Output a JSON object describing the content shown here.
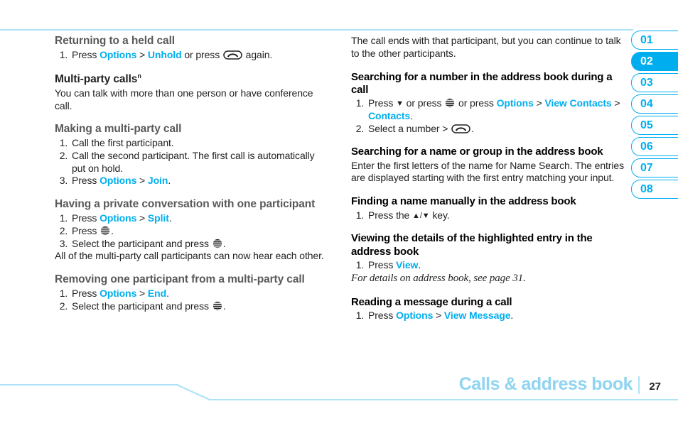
{
  "page": {
    "footer_title": "Calls & address book",
    "page_number": "27"
  },
  "tabs": [
    {
      "label": "01",
      "active": false
    },
    {
      "label": "02",
      "active": true
    },
    {
      "label": "03",
      "active": false
    },
    {
      "label": "04",
      "active": false
    },
    {
      "label": "05",
      "active": false
    },
    {
      "label": "06",
      "active": false
    },
    {
      "label": "07",
      "active": false
    },
    {
      "label": "08",
      "active": false
    }
  ],
  "left_column": {
    "s1": {
      "heading": "Returning to a held call",
      "step1_a": "Press ",
      "step1_options": "Options",
      "step1_gt": " > ",
      "step1_unhold": "Unhold",
      "step1_b": " or press ",
      "step1_c": " again."
    },
    "s2": {
      "heading": "Multi-party calls",
      "heading_sup": "n",
      "body": "You can talk with more than one person or have conference call."
    },
    "s3": {
      "heading": "Making a multi-party call",
      "step1": "Call the first participant.",
      "step2": "Call the second participant. The first call is automatically put on hold.",
      "step3_a": "Press ",
      "step3_options": "Options",
      "step3_gt": " > ",
      "step3_join": "Join",
      "step3_b": "."
    },
    "s4": {
      "heading": "Having a private conversation with one participant",
      "step1_a": "Press ",
      "step1_options": "Options",
      "step1_gt": " > ",
      "step1_split": "Split",
      "step1_b": ".",
      "step2_a": "Press ",
      "step2_b": ".",
      "step3_a": "Select the participant and press ",
      "step3_b": ".",
      "note": "All of the multi-party call participants can now hear each other."
    },
    "s5": {
      "heading": "Removing one participant from a multi-party call",
      "step1_a": "Press ",
      "step1_options": "Options",
      "step1_gt": " > ",
      "step1_end": "End",
      "step1_b": ".",
      "step2_a": "Select the participant and press ",
      "step2_b": "."
    }
  },
  "right_column": {
    "s0": {
      "body": "The call ends with that participant, but you can continue to talk to the other participants."
    },
    "s1": {
      "heading": "Searching for a number in the address book during a call",
      "step1_a": "Press ",
      "step1_down": "▼",
      "step1_b": " or press ",
      "step1_c": " or press ",
      "step1_options": "Options",
      "step1_gt1": " > ",
      "step1_viewcontacts": "View Contacts",
      "step1_gt2": " > ",
      "step1_contacts": "Contacts",
      "step1_d": ".",
      "step2_a": "Select a number > ",
      "step2_b": "."
    },
    "s2": {
      "heading": "Searching for a name or group in the address book",
      "body": "Enter the first letters of the name for Name Search. The entries are displayed starting with the first entry matching your input."
    },
    "s3": {
      "heading": "Finding a name manually in the address book",
      "step1_a": "Press the ",
      "step1_keys": "▲/▼",
      "step1_b": " key."
    },
    "s4": {
      "heading": "Viewing the details of the highlighted entry in the address book",
      "step1_a": "Press ",
      "step1_view": "View",
      "step1_b": ".",
      "note": "For details on address book, see page 31."
    },
    "s5": {
      "heading": "Reading a message during a call",
      "step1_a": "Press ",
      "step1_options": "Options",
      "step1_gt": " > ",
      "step1_viewmessage": "View Message",
      "step1_b": "."
    }
  },
  "icons": {
    "send_key": "send-key-icon",
    "att_globe": "att-globe-icon",
    "arrow_down": "arrow-down-icon",
    "arrow_up_down": "arrow-up-down-icon"
  },
  "colors": {
    "link": "#00aeef",
    "rule": "#aee3f7",
    "footer_title": "#8fd4f0",
    "heading_gray": "#58595b"
  }
}
